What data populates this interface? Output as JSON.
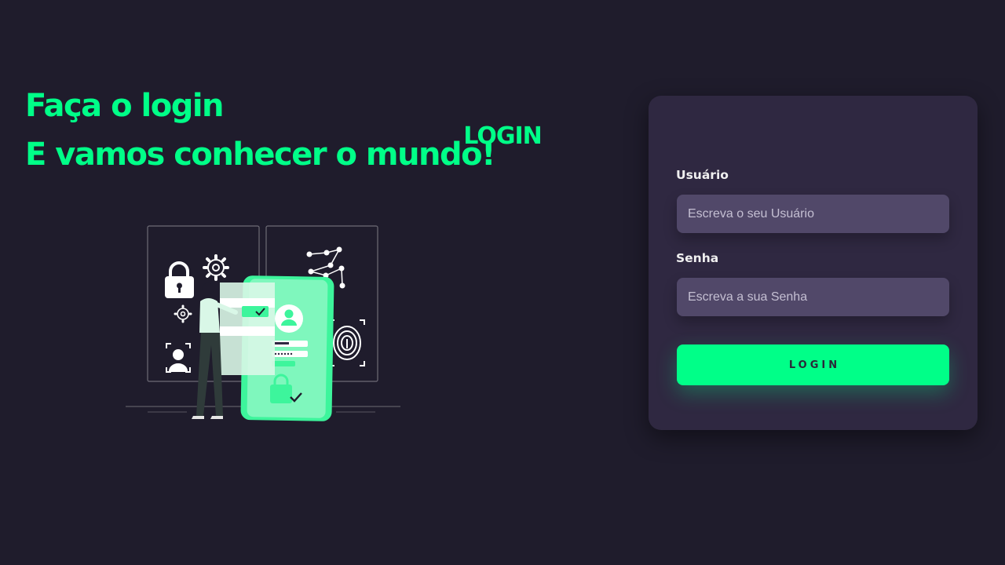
{
  "hero": {
    "line1": "Faça o login",
    "line2": "E vamos conhecer o mundo!"
  },
  "illustration": {
    "icon": "security-login-illustration"
  },
  "login_card": {
    "title": "LOGIN",
    "username": {
      "label": "Usuário",
      "placeholder": "Escreva o seu Usuário",
      "value": ""
    },
    "password": {
      "label": "Senha",
      "placeholder": "Escreva a sua Senha",
      "value": ""
    },
    "submit_label": "LOGIN"
  },
  "colors": {
    "background": "#1f1c2c",
    "accent": "#00ff88",
    "card": "#2f2841",
    "input": "#514869"
  }
}
